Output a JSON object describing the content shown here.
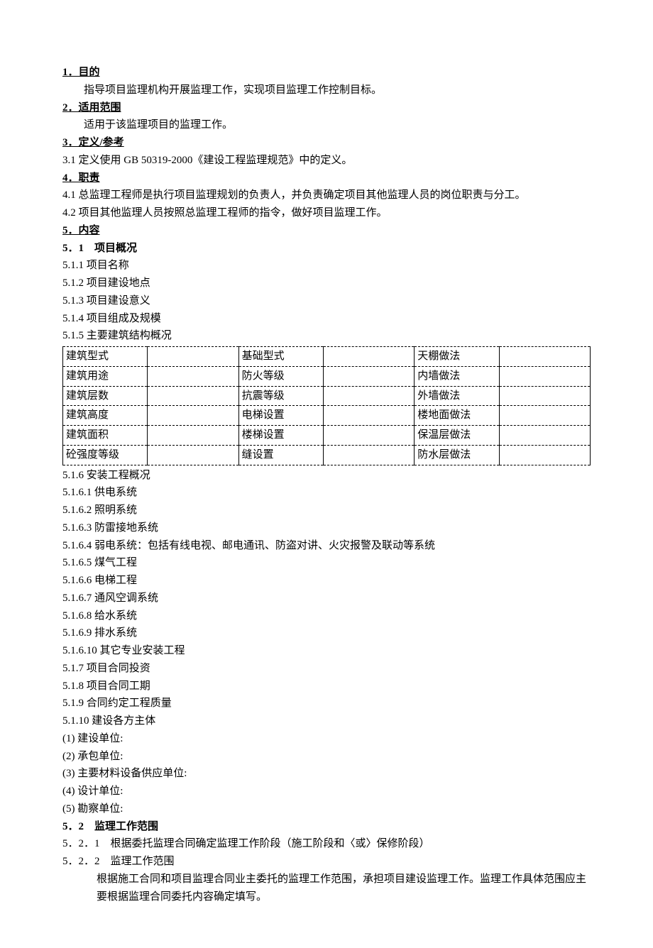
{
  "s1": {
    "title": "1．目的",
    "body": "指导项目监理机构开展监理工作，实现项目监理工作控制目标。"
  },
  "s2": {
    "title": "2．适用范围",
    "body": "适用于该监理项目的监理工作。"
  },
  "s3": {
    "title": "3．定义/参考",
    "i1": "3.1 定义使用 GB 50319-2000《建设工程监理规范》中的定义。"
  },
  "s4": {
    "title": "4．职责",
    "i1": "4.1 总监理工程师是执行项目监理规划的负责人，并负责确定项目其他监理人员的岗位职责与分工。",
    "i2": "4.2 项目其他监理人员按照总监理工程师的指令，做好项目监理工作。"
  },
  "s5": {
    "title": "5．内容"
  },
  "s5_1": {
    "title": "5．1　项目概况",
    "i1": "5.1.1 项目名称",
    "i2": "5.1.2 项目建设地点",
    "i3": "5.1.3 项目建设意义",
    "i4": "5.1.4 项目组成及规模",
    "i5": "5.1.5 主要建筑结构概况"
  },
  "table": {
    "r1": {
      "c1": "建筑型式",
      "c2": "基础型式",
      "c3": "天棚做法"
    },
    "r2": {
      "c1": "建筑用途",
      "c2": "防火等级",
      "c3": "内墙做法"
    },
    "r3": {
      "c1": "建筑层数",
      "c2": "抗震等级",
      "c3": "外墙做法"
    },
    "r4": {
      "c1": "建筑高度",
      "c2": "电梯设置",
      "c3": "楼地面做法"
    },
    "r5": {
      "c1": "建筑面积",
      "c2": "楼梯设置",
      "c3": "保温层做法"
    },
    "r6": {
      "c1": "砼强度等级",
      "c2": "缝设置",
      "c3": "防水层做法"
    }
  },
  "s5_1_6": {
    "title": "5.1.6 安装工程概况",
    "i1": "5.1.6.1 供电系统",
    "i2": "5.1.6.2 照明系统",
    "i3": "5.1.6.3 防雷接地系统",
    "i4": "5.1.6.4 弱电系统：包括有线电视、邮电通讯、防盗对讲、火灾报警及联动等系统",
    "i5": "5.1.6.5 煤气工程",
    "i6": "5.1.6.6 电梯工程",
    "i7": "5.1.6.7 通风空调系统",
    "i8": "5.1.6.8 给水系统",
    "i9": "5.1.6.9 排水系统",
    "i10": "5.1.6.10 其它专业安装工程"
  },
  "s5_1_rest": {
    "i7": "5.1.7 项目合同投资",
    "i8": "5.1.8 项目合同工期",
    "i9": "5.1.9 合同约定工程质量",
    "i10": "5.1.10 建设各方主体",
    "p1": "(1) 建设单位:",
    "p2": "(2) 承包单位:",
    "p3": "(3) 主要材料设备供应单位:",
    "p4": "(4) 设计单位:",
    "p5": "(5) 勘察单位:"
  },
  "s5_2": {
    "title": "5．2　监理工作范围",
    "i1": "5．2．1　根据委托监理合同确定监理工作阶段（施工阶段和〈或〉保修阶段）",
    "i2": "5．2．2　监理工作范围",
    "b1": "根据施工合同和项目监理合同业主委托的监理工作范围，承担项目建设监理工作。监理工作具体范围应主要根据监理合同委托内容确定填写。"
  }
}
